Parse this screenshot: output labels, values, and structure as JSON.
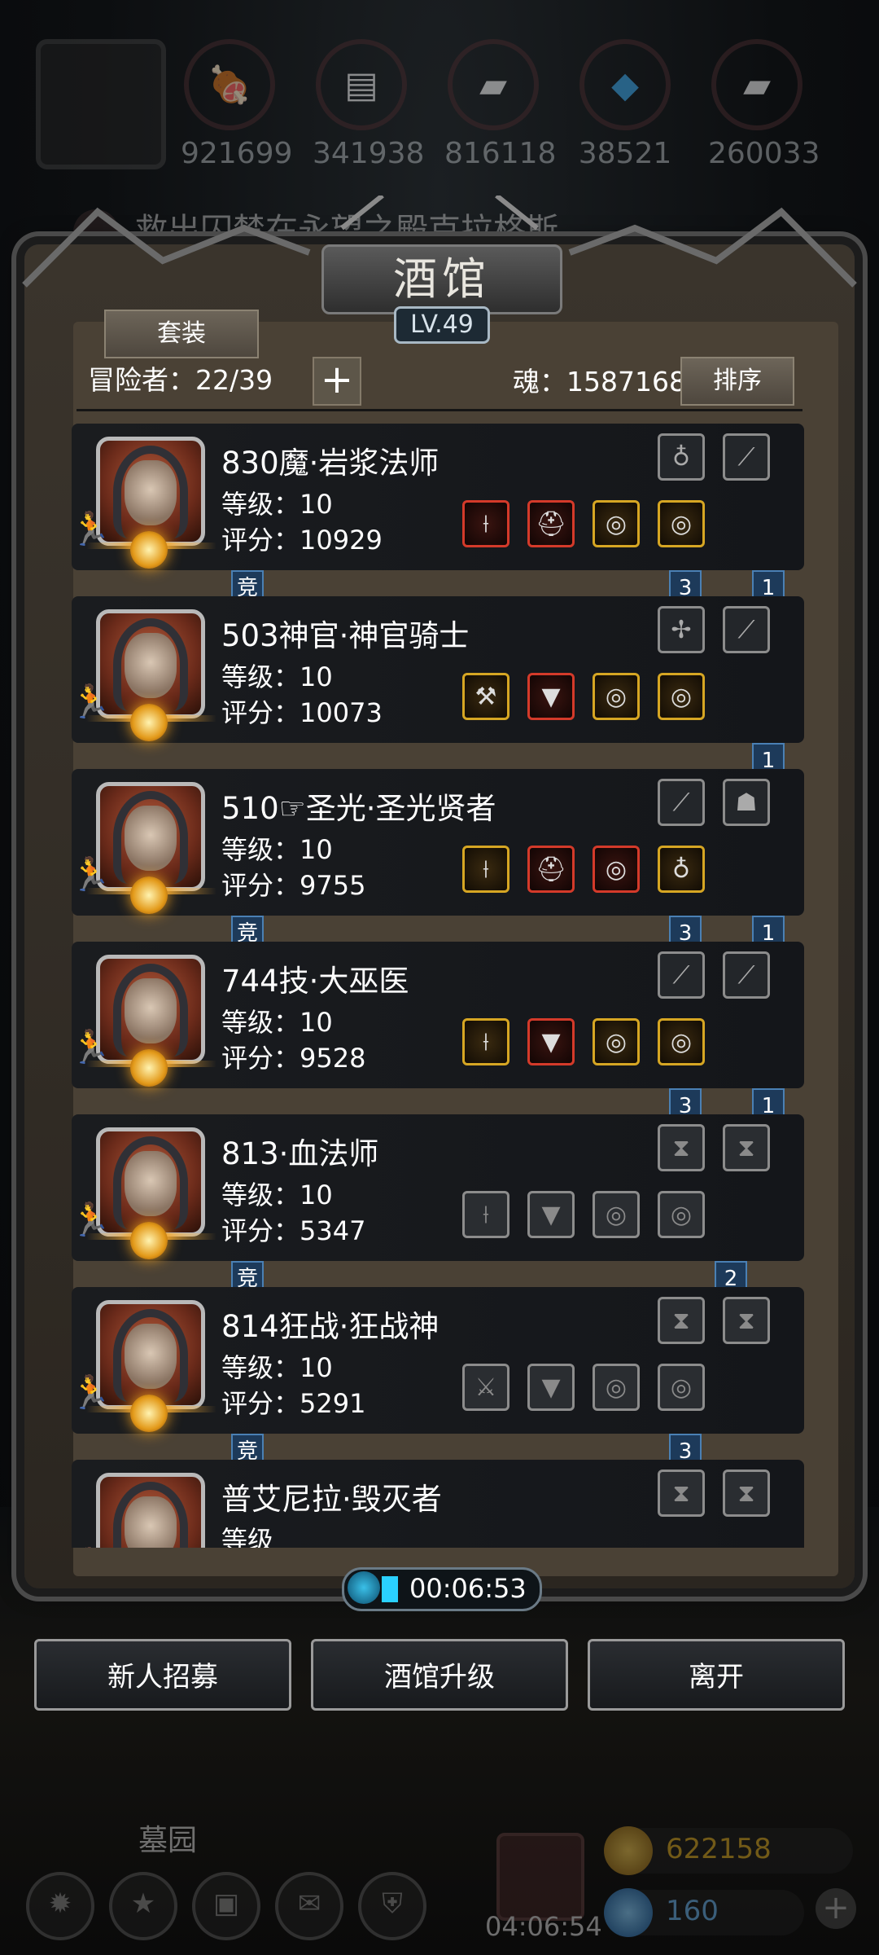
{
  "top_bar": {
    "resources": [
      {
        "icon": "meat-icon",
        "value": "921699"
      },
      {
        "icon": "wood-icon",
        "value": "341938"
      },
      {
        "icon": "iron-icon",
        "value": "816118"
      },
      {
        "icon": "crystal-icon",
        "value": "38521"
      },
      {
        "icon": "stone-icon",
        "value": "260033"
      }
    ],
    "quest_text": "救出囚禁在永望之殿克拉格斯"
  },
  "tavern": {
    "title": "酒馆",
    "level": "LV.49",
    "suit_label": "套装",
    "adventurers_label": "冒险者：22/39",
    "add_label": "+",
    "soul_label": "魂：1587168",
    "sort_label": "排序"
  },
  "heroes": [
    {
      "name": "830魔·岩浆法师",
      "level": "等级：10",
      "score": "评分：10929",
      "compete": "竞",
      "badges": [
        "3",
        "1"
      ],
      "gear_top": [
        "necklace-icon",
        "bow-icon"
      ],
      "gear_bottom": [
        "staff-icon",
        "helmet-icon",
        "ring-icon",
        "ring-icon"
      ],
      "gear_bottom_style": [
        "red",
        "red",
        "gold",
        "gold"
      ],
      "gear_top_style": [
        "grey",
        "grey"
      ]
    },
    {
      "name": "503神官·神官骑士",
      "level": "等级：10",
      "score": "评分：10073",
      "compete": "",
      "badges": [
        "1"
      ],
      "gear_top": [
        "crossbow-icon",
        "bow-icon"
      ],
      "gear_bottom": [
        "hammer-icon",
        "armor-icon",
        "ring-icon",
        "ring-icon"
      ],
      "gear_bottom_style": [
        "gold",
        "red",
        "gold",
        "gold"
      ],
      "gear_top_style": [
        "grey",
        "grey"
      ]
    },
    {
      "name": "510☞圣光·圣光贤者",
      "level": "等级：10",
      "score": "评分：9755",
      "compete": "竞",
      "badges": [
        "3",
        "1"
      ],
      "gear_top": [
        "sword-icon",
        "mask-icon"
      ],
      "gear_bottom": [
        "staff-icon",
        "helmet-icon",
        "ring-icon",
        "necklace-icon"
      ],
      "gear_bottom_style": [
        "gold",
        "red",
        "red",
        "gold"
      ],
      "gear_top_style": [
        "grey",
        "grey"
      ]
    },
    {
      "name": "744技·大巫医",
      "level": "等级：10",
      "score": "评分：9528",
      "compete": "",
      "badges": [
        "3",
        "1"
      ],
      "gear_top": [
        "bow-icon",
        "bow-icon"
      ],
      "gear_bottom": [
        "staff-icon",
        "armor-icon",
        "ring-icon",
        "ring-icon"
      ],
      "gear_bottom_style": [
        "gold",
        "red",
        "gold",
        "gold"
      ],
      "gear_top_style": [
        "grey",
        "grey"
      ]
    },
    {
      "name": "813·血法师",
      "level": "等级：10",
      "score": "评分：5347",
      "compete": "竞",
      "badges": [
        "2"
      ],
      "gear_top": [
        "empty-slot-icon",
        "empty-slot-icon"
      ],
      "gear_bottom": [
        "staff-icon",
        "armor-icon",
        "ring-icon",
        "ring-icon"
      ],
      "gear_bottom_style": [
        "empty",
        "empty",
        "empty",
        "empty"
      ],
      "gear_top_style": [
        "empty",
        "empty"
      ]
    },
    {
      "name": "814狂战·狂战神",
      "level": "等级：10",
      "score": "评分：5291",
      "compete": "竞",
      "badges": [
        "3"
      ],
      "gear_top": [
        "empty-slot-icon",
        "empty-slot-icon"
      ],
      "gear_bottom": [
        "axe-icon",
        "armor-icon",
        "ring-icon",
        "ring-icon"
      ],
      "gear_bottom_style": [
        "empty",
        "empty",
        "empty",
        "empty"
      ],
      "gear_top_style": [
        "empty",
        "empty"
      ]
    },
    {
      "name": "普艾尼拉·毁灭者",
      "level": "等级",
      "score": "",
      "compete": "",
      "badges": [],
      "gear_top": [
        "empty-slot-icon",
        "empty-slot-icon"
      ],
      "gear_bottom": [],
      "gear_bottom_style": [],
      "gear_top_style": [
        "empty",
        "empty"
      ]
    }
  ],
  "timer": "00:06:53",
  "actions": {
    "recruit": "新人招募",
    "upgrade": "酒馆升级",
    "leave": "离开"
  },
  "bottom": {
    "graveyard": "墓园",
    "gift_timer": "04:06:54",
    "gold": "622158",
    "gems": "160"
  }
}
